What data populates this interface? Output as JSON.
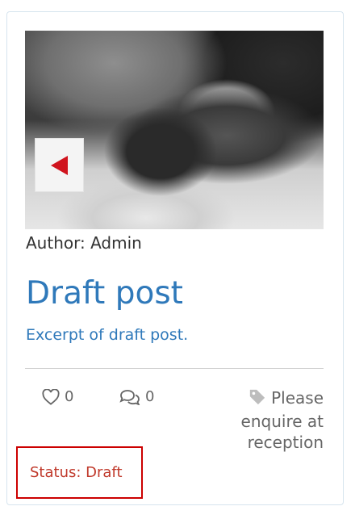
{
  "post": {
    "author_text": "Author: Admin",
    "title": "Draft post",
    "excerpt": "Excerpt of draft post.",
    "likes_count": "0",
    "comments_count": "0",
    "notice": "Please enquire at reception",
    "status": "Status: Draft"
  },
  "icons": {
    "prev": "triangle-left-icon",
    "like": "heart-outline-icon",
    "comment": "chat-bubbles-outline-icon",
    "tag": "tag-icon"
  },
  "colors": {
    "title": "#2f79ba",
    "status": "#c0392b",
    "status_border": "#cc0000",
    "prev_arrow": "#d0141e"
  }
}
